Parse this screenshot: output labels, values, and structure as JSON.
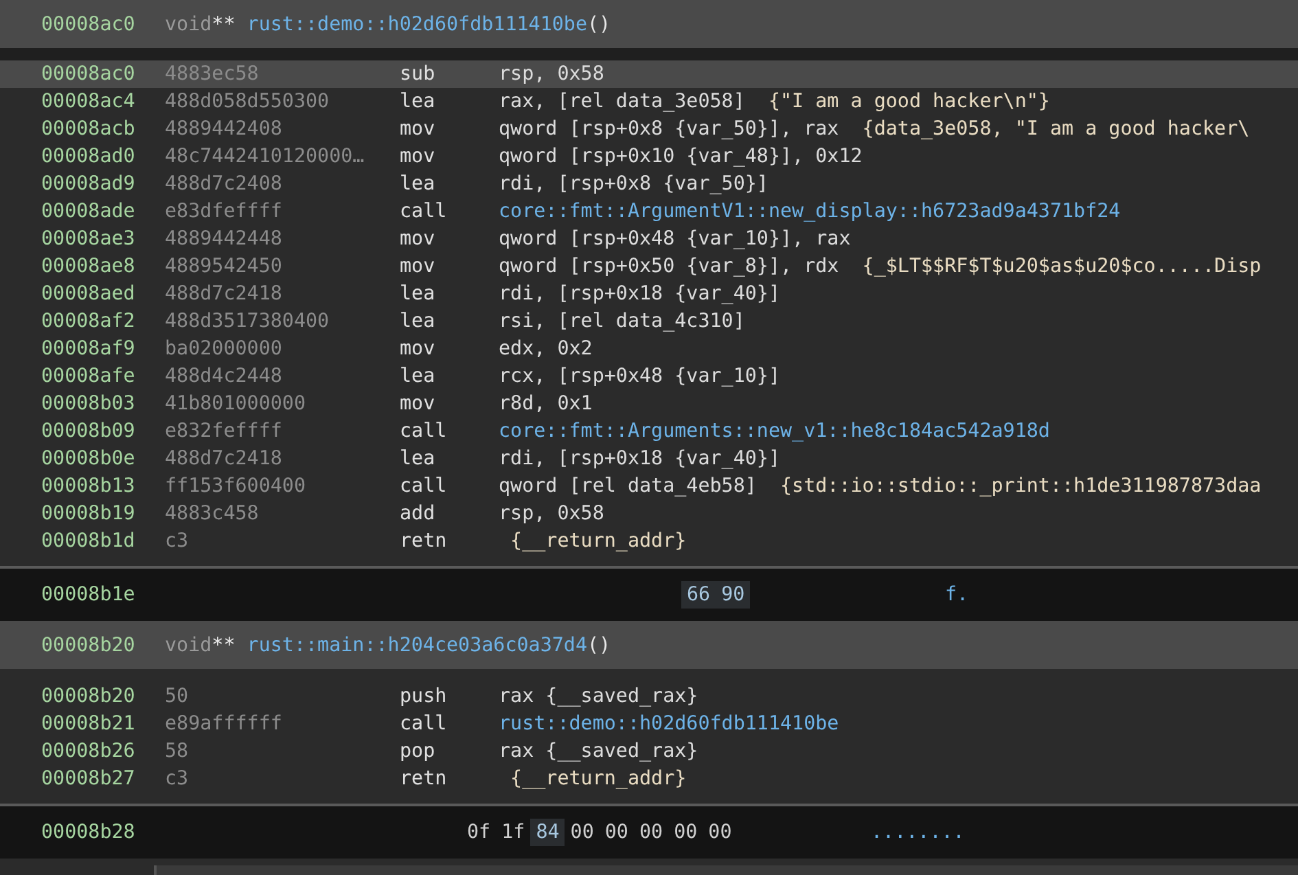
{
  "functions": [
    {
      "header": {
        "address": "00008ac0",
        "return_type": "void",
        "pointer": "**",
        "name": "rust::demo::h02d60fdb111410be",
        "parens": "()"
      },
      "instructions": [
        {
          "address": "00008ac0",
          "bytes": "4883ec58",
          "mnemonic": "sub",
          "selected": true,
          "operands": [
            {
              "kind": "plain",
              "text": "rsp, 0x58"
            }
          ]
        },
        {
          "address": "00008ac4",
          "bytes": "488d058d550300",
          "mnemonic": "lea",
          "selected": false,
          "operands": [
            {
              "kind": "plain",
              "text": "rax, [rel data_3e058]"
            },
            {
              "kind": "annotation",
              "text": "{\"I am a good hacker\\n\"}"
            }
          ]
        },
        {
          "address": "00008acb",
          "bytes": "4889442408",
          "mnemonic": "mov",
          "selected": false,
          "operands": [
            {
              "kind": "plain",
              "text": "qword [rsp+0x8 {var_50}], rax"
            },
            {
              "kind": "annotation",
              "text": "{data_3e058, \"I am a good hacker\\"
            }
          ]
        },
        {
          "address": "00008ad0",
          "bytes": "48c7442410120000…",
          "mnemonic": "mov",
          "selected": false,
          "operands": [
            {
              "kind": "plain",
              "text": "qword [rsp+0x10 {var_48}], 0x12"
            }
          ]
        },
        {
          "address": "00008ad9",
          "bytes": "488d7c2408",
          "mnemonic": "lea",
          "selected": false,
          "operands": [
            {
              "kind": "plain",
              "text": "rdi, [rsp+0x8 {var_50}]"
            }
          ]
        },
        {
          "address": "00008ade",
          "bytes": "e83dfeffff",
          "mnemonic": "call",
          "selected": false,
          "operands": [
            {
              "kind": "symbol",
              "text": "core::fmt::ArgumentV1::new_display::h6723ad9a4371bf24"
            }
          ]
        },
        {
          "address": "00008ae3",
          "bytes": "4889442448",
          "mnemonic": "mov",
          "selected": false,
          "operands": [
            {
              "kind": "plain",
              "text": "qword [rsp+0x48 {var_10}], rax"
            }
          ]
        },
        {
          "address": "00008ae8",
          "bytes": "4889542450",
          "mnemonic": "mov",
          "selected": false,
          "operands": [
            {
              "kind": "plain",
              "text": "qword [rsp+0x50 {var_8}], rdx"
            },
            {
              "kind": "annotation",
              "text": "{_$LT$$RF$T$u20$as$u20$co.....Disp"
            }
          ]
        },
        {
          "address": "00008aed",
          "bytes": "488d7c2418",
          "mnemonic": "lea",
          "selected": false,
          "operands": [
            {
              "kind": "plain",
              "text": "rdi, [rsp+0x18 {var_40}]"
            }
          ]
        },
        {
          "address": "00008af2",
          "bytes": "488d3517380400",
          "mnemonic": "lea",
          "selected": false,
          "operands": [
            {
              "kind": "plain",
              "text": "rsi, [rel data_4c310]"
            }
          ]
        },
        {
          "address": "00008af9",
          "bytes": "ba02000000",
          "mnemonic": "mov",
          "selected": false,
          "operands": [
            {
              "kind": "plain",
              "text": "edx, 0x2"
            }
          ]
        },
        {
          "address": "00008afe",
          "bytes": "488d4c2448",
          "mnemonic": "lea",
          "selected": false,
          "operands": [
            {
              "kind": "plain",
              "text": "rcx, [rsp+0x48 {var_10}]"
            }
          ]
        },
        {
          "address": "00008b03",
          "bytes": "41b801000000",
          "mnemonic": "mov",
          "selected": false,
          "operands": [
            {
              "kind": "plain",
              "text": "r8d, 0x1"
            }
          ]
        },
        {
          "address": "00008b09",
          "bytes": "e832feffff",
          "mnemonic": "call",
          "selected": false,
          "operands": [
            {
              "kind": "symbol",
              "text": "core::fmt::Arguments::new_v1::he8c184ac542a918d"
            }
          ]
        },
        {
          "address": "00008b0e",
          "bytes": "488d7c2418",
          "mnemonic": "lea",
          "selected": false,
          "operands": [
            {
              "kind": "plain",
              "text": "rdi, [rsp+0x18 {var_40}]"
            }
          ]
        },
        {
          "address": "00008b13",
          "bytes": "ff153f600400",
          "mnemonic": "call",
          "selected": false,
          "operands": [
            {
              "kind": "plain",
              "text": "qword [rel data_4eb58]"
            },
            {
              "kind": "annotation",
              "text": "{std::io::stdio::_print::h1de311987873daa"
            }
          ]
        },
        {
          "address": "00008b19",
          "bytes": "4883c458",
          "mnemonic": "add",
          "selected": false,
          "operands": [
            {
              "kind": "plain",
              "text": "rsp, 0x58"
            }
          ]
        },
        {
          "address": "00008b1d",
          "bytes": "c3",
          "mnemonic": "retn",
          "selected": false,
          "operands": [
            {
              "kind": "annotation",
              "text": "{__return_addr}"
            }
          ]
        }
      ],
      "data_row": {
        "address": "00008b1e",
        "bytes": [
          {
            "text": "66",
            "highlighted": true
          },
          {
            "text": "90",
            "highlighted": true
          }
        ],
        "ascii": "f."
      }
    },
    {
      "header": {
        "address": "00008b20",
        "return_type": "void",
        "pointer": "**",
        "name": "rust::main::h204ce03a6c0a37d4",
        "parens": "()"
      },
      "instructions": [
        {
          "address": "00008b20",
          "bytes": "50",
          "mnemonic": "push",
          "selected": false,
          "operands": [
            {
              "kind": "plain",
              "text": "rax {__saved_rax}"
            }
          ]
        },
        {
          "address": "00008b21",
          "bytes": "e89affffff",
          "mnemonic": "call",
          "selected": false,
          "operands": [
            {
              "kind": "symbol",
              "text": "rust::demo::h02d60fdb111410be"
            }
          ]
        },
        {
          "address": "00008b26",
          "bytes": "58",
          "mnemonic": "pop",
          "selected": false,
          "operands": [
            {
              "kind": "plain",
              "text": "rax {__saved_rax}"
            }
          ]
        },
        {
          "address": "00008b27",
          "bytes": "c3",
          "mnemonic": "retn",
          "selected": false,
          "operands": [
            {
              "kind": "annotation",
              "text": "{__return_addr}"
            }
          ]
        }
      ],
      "data_row": {
        "address": "00008b28",
        "bytes": [
          {
            "text": "0f",
            "highlighted": false
          },
          {
            "text": "1f",
            "highlighted": false
          },
          {
            "text": "84",
            "highlighted": true
          },
          {
            "text": "00",
            "highlighted": false
          },
          {
            "text": "00",
            "highlighted": false
          },
          {
            "text": "00",
            "highlighted": false
          },
          {
            "text": "00",
            "highlighted": false
          },
          {
            "text": "00",
            "highlighted": false
          }
        ],
        "ascii": "........"
      }
    }
  ]
}
